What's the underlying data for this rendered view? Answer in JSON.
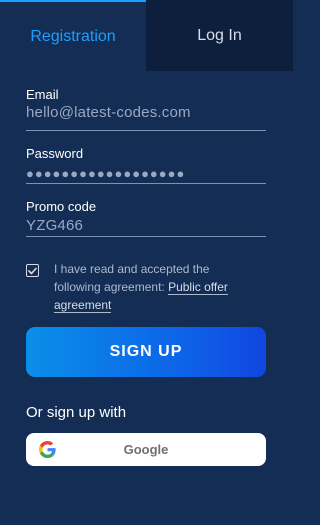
{
  "tabs": {
    "registration": "Registration",
    "login": "Log In"
  },
  "form": {
    "email": {
      "label": "Email",
      "value": "hello@latest-codes.com"
    },
    "password": {
      "label": "Password",
      "value": "●●●●●●●●●●●●●●●●●●"
    },
    "promo": {
      "label": "Promo code",
      "value": "YZG466"
    }
  },
  "agreement": {
    "text": "I have read and accepted the following agreement: ",
    "link": "Public offer agreement",
    "checked": true
  },
  "signup_button": "SIGN UP",
  "social": {
    "heading": "Or sign up with",
    "google_label": "Google",
    "google_icon": "google-icon"
  },
  "colors": {
    "background": "#132d55",
    "active_tab": "#1ca0ff",
    "inactive_tab_bg": "#0d1f3d",
    "button_gradient_start": "#0a8fe8",
    "button_gradient_end": "#1146e0"
  }
}
